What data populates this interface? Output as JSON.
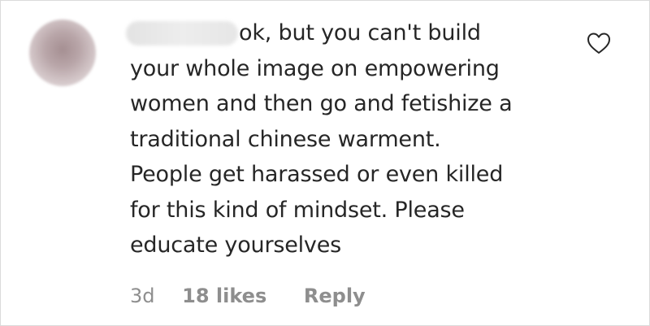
{
  "comment": {
    "username": "",
    "lines": [
      "ok, but you can't build",
      "your whole image on empowering",
      "women and then go and fetishize a",
      "traditional chinese warment.",
      "People get harassed or even killed",
      "for this kind of mindset. Please",
      "educate yourselves"
    ],
    "time": "3d",
    "likes": "18 likes",
    "reply_label": "Reply"
  },
  "icons": {
    "like": "heart-outline-icon",
    "avatar": "blurred-profile-avatar"
  },
  "colors": {
    "text": "#262626",
    "meta": "#8e8e8e",
    "border": "#dbdbdb"
  }
}
